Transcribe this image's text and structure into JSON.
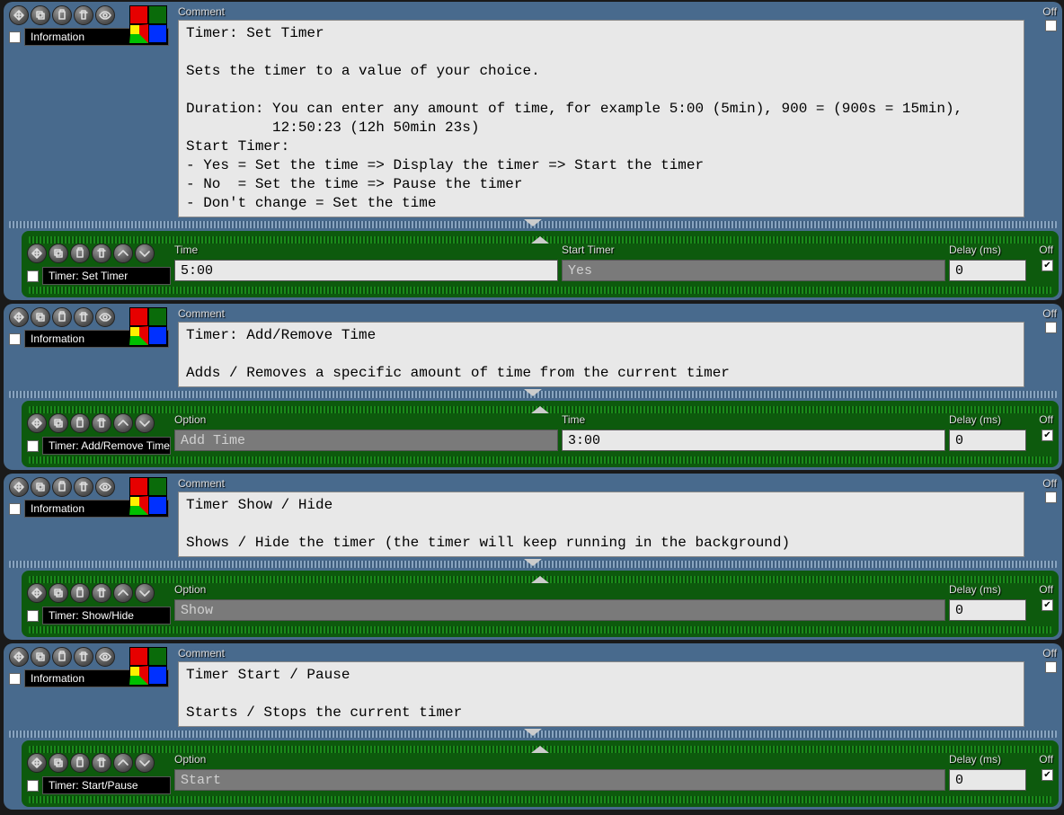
{
  "labels": {
    "comment": "Comment",
    "off": "Off",
    "time": "Time",
    "start_timer": "Start Timer",
    "delay": "Delay (ms)",
    "option": "Option"
  },
  "comment_title": "Information",
  "blocks": [
    {
      "comment": "Timer: Set Timer\n\nSets the timer to a value of your choice.\n\nDuration: You can enter any amount of time, for example 5:00 (5min), 900 = (900s = 15min),\n          12:50:23 (12h 50min 23s)\nStart Timer:\n- Yes = Set the time => Display the timer => Start the timer\n- No  = Set the time => Pause the timer\n- Don't change = Set the time",
      "action": {
        "title": "Timer: Set Timer",
        "fields": [
          [
            "time",
            "txt",
            "5:00"
          ],
          [
            "start_timer",
            "sel",
            "Yes"
          ]
        ],
        "delay": "0",
        "off": true
      }
    },
    {
      "comment": "Timer: Add/Remove Time\n\nAdds / Removes a specific amount of time from the current timer",
      "action": {
        "title": "Timer: Add/Remove Time",
        "fields": [
          [
            "option",
            "sel",
            "Add Time"
          ],
          [
            "time",
            "txt",
            "3:00"
          ]
        ],
        "delay": "0",
        "off": true
      }
    },
    {
      "comment": "Timer Show / Hide\n\nShows / Hide the timer (the timer will keep running in the background)",
      "action": {
        "title": "Timer: Show/Hide",
        "fields": [
          [
            "option",
            "sel",
            "Show"
          ]
        ],
        "delay": "0",
        "off": true
      }
    },
    {
      "comment": "Timer Start / Pause\n\nStarts / Stops the current timer",
      "action": {
        "title": "Timer: Start/Pause",
        "fields": [
          [
            "option",
            "sel",
            "Start"
          ]
        ],
        "delay": "0",
        "off": true
      }
    }
  ]
}
